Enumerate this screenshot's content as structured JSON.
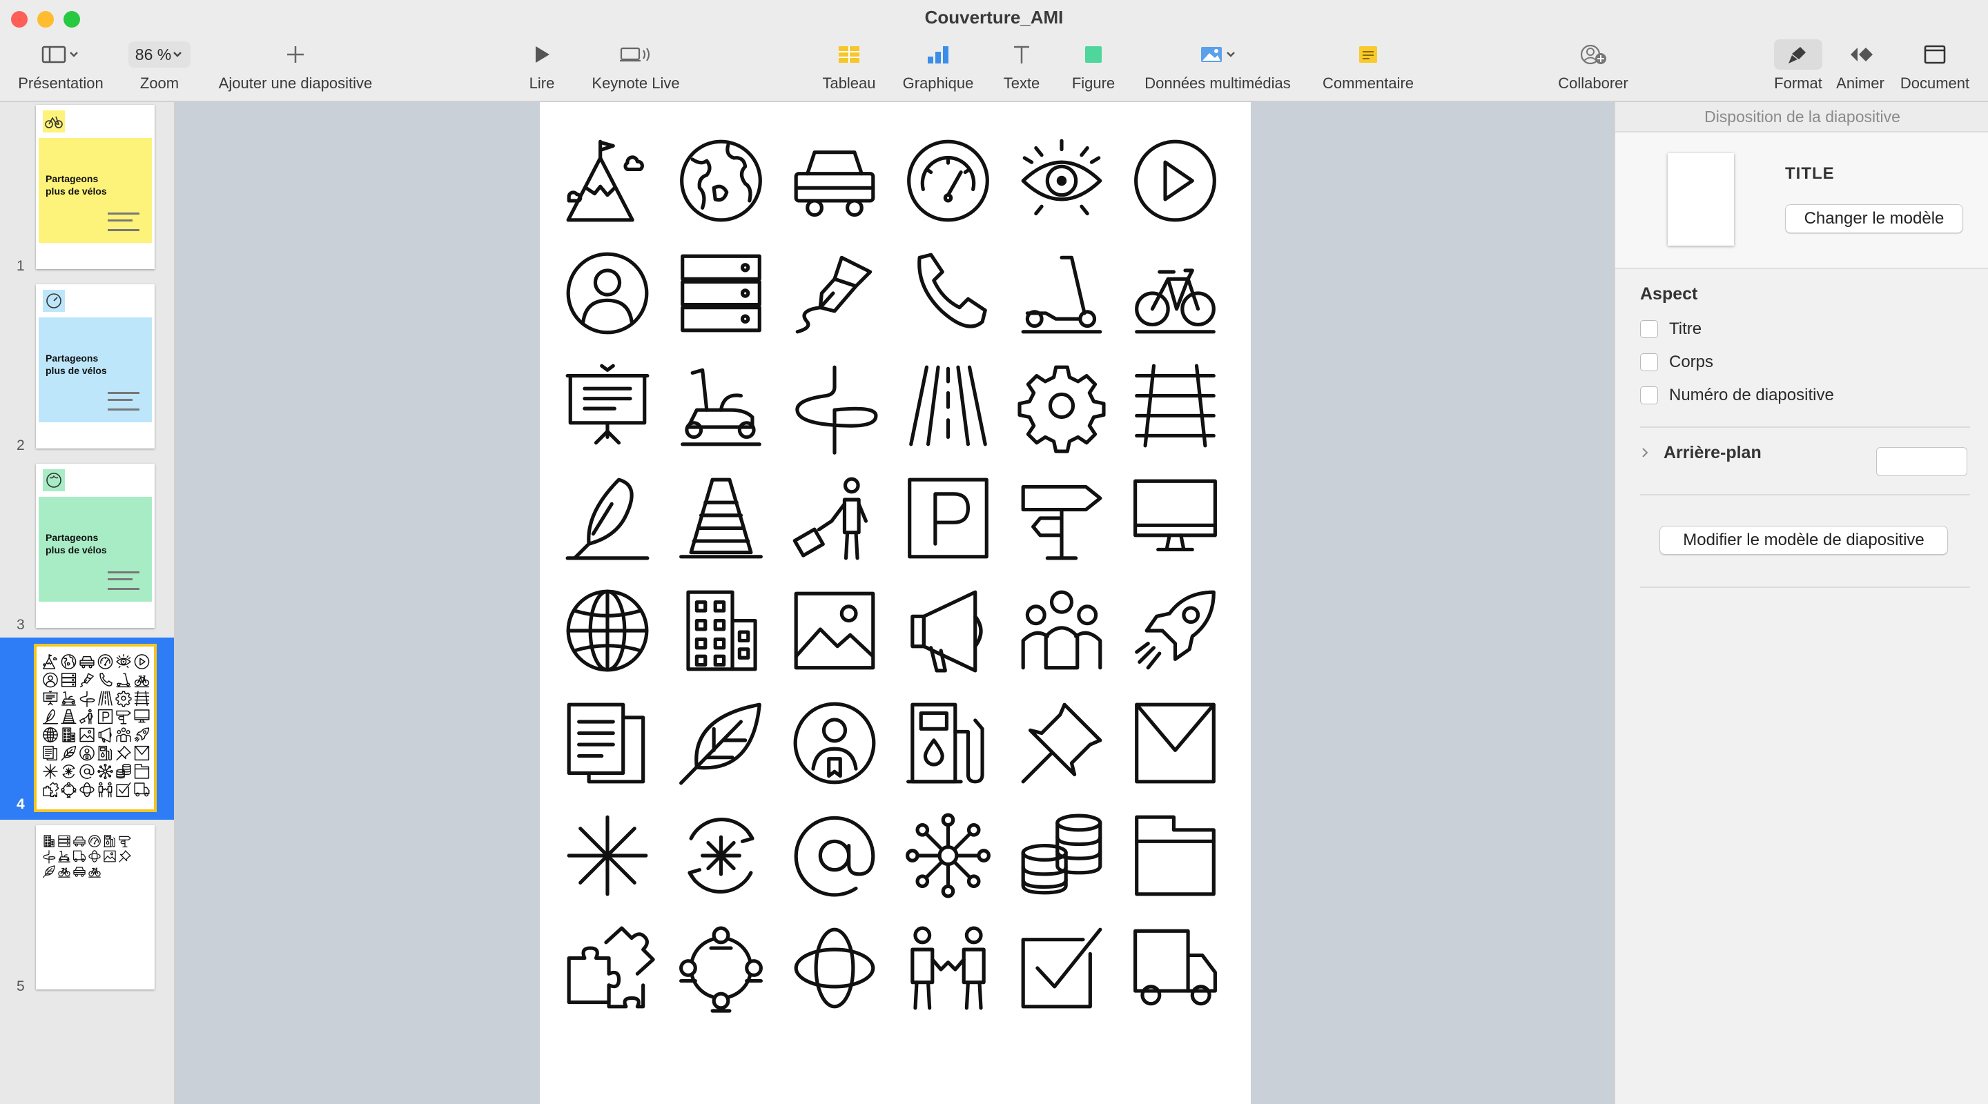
{
  "window": {
    "title": "Couverture_AMI"
  },
  "toolbar": {
    "presentation": "Présentation",
    "zoom_label": "Zoom",
    "zoom_value": "86 %",
    "add_slide": "Ajouter une diapositive",
    "play": "Lire",
    "keynote_live": "Keynote Live",
    "table": "Tableau",
    "chart": "Graphique",
    "text": "Texte",
    "shape": "Figure",
    "media": "Données multimédias",
    "comment": "Commentaire",
    "collaborate": "Collaborer",
    "format": "Format",
    "animate": "Animer",
    "document": "Document"
  },
  "navigator": {
    "selected_index": 4,
    "slides": [
      {
        "number": "1",
        "band_color": "#fdf27a",
        "title": "Partageons plus de vélos"
      },
      {
        "number": "2",
        "band_color": "#bde6fa",
        "title": "Partageons plus de vélos"
      },
      {
        "number": "3",
        "band_color": "#a8ecc6",
        "title": "Partageons plus de vélos"
      },
      {
        "number": "4",
        "band_color": "#ffffff",
        "title": ""
      },
      {
        "number": "5",
        "band_color": "#ffffff",
        "title": ""
      }
    ]
  },
  "slide": {
    "icons": [
      "mountain-flag-icon",
      "globe-earth-icon",
      "car-icon",
      "speedometer-icon",
      "eye-icon",
      "play-circle-icon",
      "user-circle-icon",
      "server-rack-icon",
      "pen-nib-icon",
      "phone-icon",
      "scooter-kick-icon",
      "bicycle-icon",
      "presentation-board-icon",
      "moped-icon",
      "winding-path-icon",
      "road-icon",
      "gear-icon",
      "railway-track-icon",
      "feather-quill-icon",
      "traffic-cone-icon",
      "traveler-luggage-icon",
      "parking-sign-icon",
      "signpost-icon",
      "monitor-icon",
      "world-grid-icon",
      "buildings-icon",
      "image-icon",
      "megaphone-icon",
      "group-people-icon",
      "rocket-icon",
      "documents-icon",
      "leaf-icon",
      "user-badge-circle-icon",
      "fuel-station-icon",
      "pushpin-icon",
      "envelope-icon",
      "asterisk-icon",
      "cycle-asterisk-icon",
      "at-sign-icon",
      "network-nodes-icon",
      "coins-stack-icon",
      "folder-icon",
      "puzzle-icon",
      "community-circle-icon",
      "orbit-icon",
      "handshake-people-icon",
      "checkbox-icon",
      "delivery-truck-icon"
    ]
  },
  "inspector": {
    "header": "Disposition de la diapositive",
    "layout_name": "TITLE",
    "change_master": "Changer le modèle",
    "aspect_title": "Aspect",
    "aspect_options": [
      {
        "label": "Titre",
        "checked": false
      },
      {
        "label": "Corps",
        "checked": false
      },
      {
        "label": "Numéro de diapositive",
        "checked": false
      }
    ],
    "background_label": "Arrière-plan",
    "edit_master": "Modifier le modèle de diapositive"
  },
  "colors": {
    "accent_blue": "#2e7cf6",
    "selection_yellow": "#f3c61f",
    "canvas_bg": "#c9d0d8"
  }
}
